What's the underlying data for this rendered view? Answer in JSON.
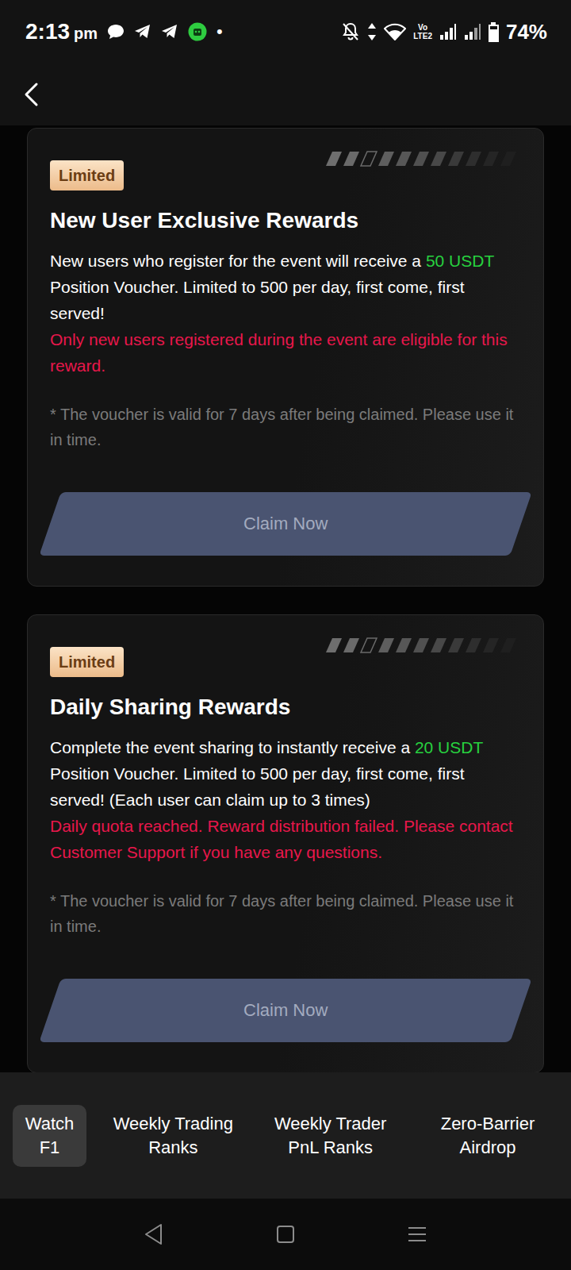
{
  "status_bar": {
    "time": "2:13",
    "meridiem": "pm",
    "more_indicator": "•",
    "network_label_top": "Vo",
    "network_label_bottom": "LTE2",
    "battery": "74%",
    "battery_level": 0.74
  },
  "cards": [
    {
      "badge": "Limited",
      "title": "New User Exclusive Rewards",
      "description_before": "New users who register for the event will receive a ",
      "amount": "50 USDT",
      "description_after": " Position Voucher. Limited to 500 per day, first come, first served!",
      "warning": "Only new users registered during the event are eligible for this reward.",
      "note": "* The voucher is valid for 7 days after being claimed. Please use it in time.",
      "button": {
        "label": "Claim Now",
        "disabled": true
      }
    },
    {
      "badge": "Limited",
      "title": "Daily Sharing Rewards",
      "description_before": "Complete the event sharing to instantly receive a ",
      "amount": "20 USDT",
      "description_after": " Position Voucher. Limited to 500 per day, first come, first served! (Each user can claim up to 3 times)",
      "warning": "Daily quota reached. Reward distribution failed. Please contact Customer Support if you have any questions.",
      "note": "* The voucher is valid for 7 days after being claimed. Please use it in time.",
      "button": {
        "label": "Claim Now",
        "disabled": true
      }
    }
  ],
  "tabs": [
    {
      "label": "Watch F1",
      "selected": true
    },
    {
      "label": "Weekly Trading Ranks",
      "selected": false
    },
    {
      "label": "Weekly Trader PnL Ranks",
      "selected": false
    },
    {
      "label": "Zero-Barrier Airdrop",
      "selected": false
    }
  ]
}
